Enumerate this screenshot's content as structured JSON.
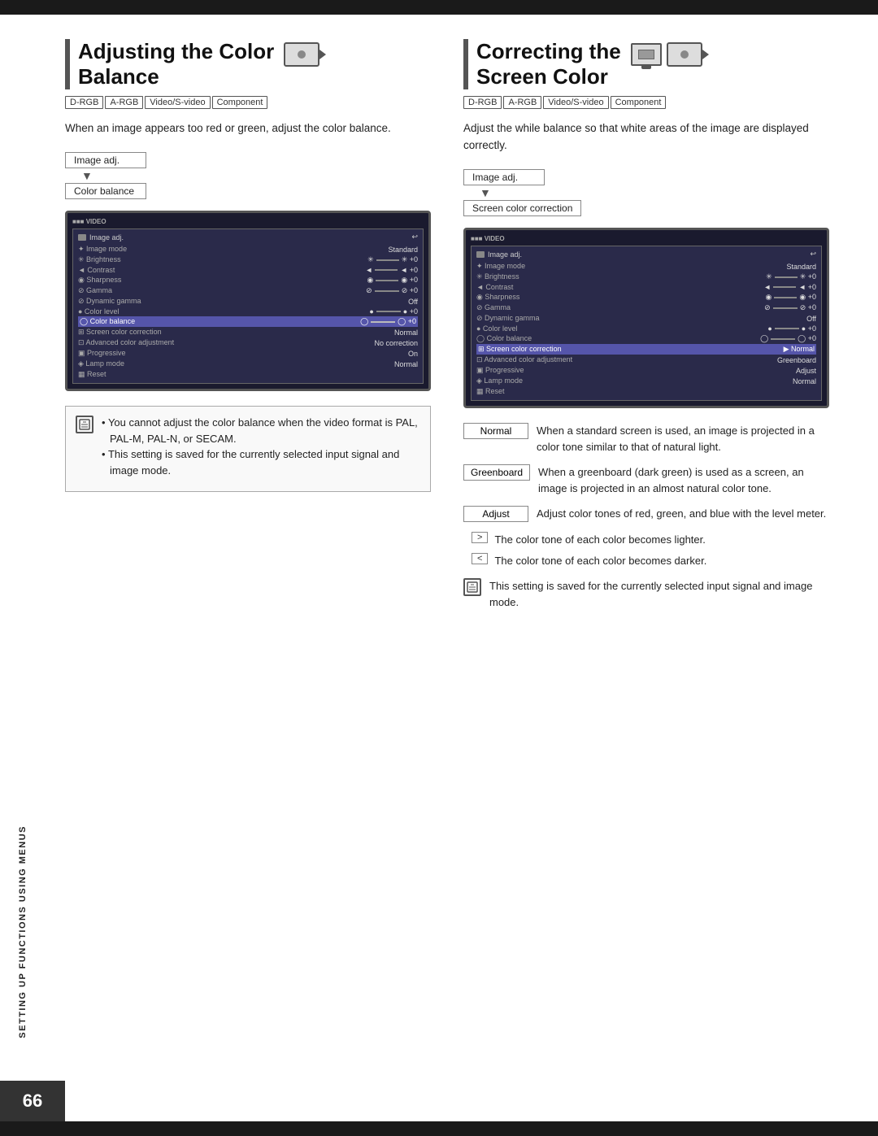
{
  "page": {
    "number": "66",
    "top_bar_color": "#1a1a1a",
    "side_label": "SETTING UP FUNCTIONS USING MENUS"
  },
  "left_section": {
    "title_line1": "Adjusting the Color",
    "title_line2": "Balance",
    "compat_tags": [
      "D-RGB",
      "A-RGB",
      "Video/S-video",
      "Component"
    ],
    "description": "When an image appears too red or green, adjust the color balance.",
    "menu_flow": {
      "item1": "Image adj.",
      "item2": "Color balance"
    },
    "video_screen": {
      "header_label": "VIDEO",
      "title": "Image adj.",
      "rows": [
        {
          "label": "Image mode",
          "value": "Standard",
          "highlighted": false
        },
        {
          "label": "Brightness",
          "value": "✳ ═══ ✳ +0",
          "highlighted": false
        },
        {
          "label": "Contrast",
          "value": "◄ ═══ ◄ +0",
          "highlighted": false
        },
        {
          "label": "Sharpness",
          "value": "◉ ═══ ◉ +0",
          "highlighted": false
        },
        {
          "label": "Gamma",
          "value": "⊘ ════ ⊘ +0",
          "highlighted": false
        },
        {
          "label": "Dynamic gamma",
          "value": "Off",
          "highlighted": false
        },
        {
          "label": "Color level",
          "value": "● ════ ● +0",
          "highlighted": false
        },
        {
          "label": "Color balance",
          "value": "◯ ════ ◯ +0",
          "highlighted": true
        },
        {
          "label": "Screen color correction",
          "value": "Normal",
          "highlighted": false
        },
        {
          "label": "Advanced color adjustment",
          "value": "No correction",
          "highlighted": false
        },
        {
          "label": "Progressive",
          "value": "On",
          "highlighted": false
        },
        {
          "label": "Lamp mode",
          "value": "Normal",
          "highlighted": false
        },
        {
          "label": "Reset",
          "value": "",
          "highlighted": false
        }
      ]
    },
    "notes": {
      "icon": "i",
      "bullets": [
        "You cannot adjust the color balance when the video format is PAL, PAL-M, PAL-N, or SECAM.",
        "This setting is saved for the currently selected input signal and image mode."
      ]
    }
  },
  "right_section": {
    "title_line1": "Correcting the",
    "title_line2": "Screen Color",
    "compat_tags": [
      "D-RGB",
      "A-RGB",
      "Video/S-video",
      "Component"
    ],
    "description": "Adjust the while balance so that white areas of the image are displayed correctly.",
    "menu_flow": {
      "item1": "Image adj.",
      "item2": "Screen color correction"
    },
    "video_screen": {
      "header_label": "VIDEO",
      "title": "Image adj.",
      "rows": [
        {
          "label": "Image mode",
          "value": "Standard",
          "highlighted": false
        },
        {
          "label": "Brightness",
          "value": "✳ ═══ ✳ +0",
          "highlighted": false
        },
        {
          "label": "Contrast",
          "value": "◄ ═══ ◄ +0",
          "highlighted": false
        },
        {
          "label": "Sharpness",
          "value": "◉ ═══ ◉ +0",
          "highlighted": false
        },
        {
          "label": "Gamma",
          "value": "⊘ ════ ⊘ +0",
          "highlighted": false
        },
        {
          "label": "Dynamic gamma",
          "value": "Off",
          "highlighted": false
        },
        {
          "label": "Color level",
          "value": "● ════ ● +0",
          "highlighted": false
        },
        {
          "label": "Color balance",
          "value": "◯ ════ ◯ +0",
          "highlighted": false
        },
        {
          "label": "Screen color correction",
          "value": "▶ Normal",
          "highlighted": true
        },
        {
          "label": "Advanced color adjustment",
          "value": "Greenboard",
          "highlighted": false
        },
        {
          "label": "Progressive",
          "value": "Adjust",
          "highlighted": false
        },
        {
          "label": "Lamp mode",
          "value": "Normal",
          "highlighted": false
        },
        {
          "label": "Reset",
          "value": "",
          "highlighted": false
        }
      ]
    },
    "correction_items": [
      {
        "label": "Normal",
        "description": "When a standard screen is used, an image is projected in a color tone similar to that of natural light."
      },
      {
        "label": "Greenboard",
        "description": "When a greenboard (dark green) is used as a screen, an image is projected in an almost natural color tone."
      },
      {
        "label": "Adjust",
        "description": "Adjust color tones of red, green, and blue with the level meter."
      }
    ],
    "arrow_items": [
      {
        "arrow": ">",
        "description": "The color tone of each color becomes lighter."
      },
      {
        "arrow": "<",
        "description": "The color tone of each color becomes darker."
      }
    ],
    "bottom_note": {
      "icon": "i",
      "text": "This setting is saved for the currently selected input signal and image mode."
    }
  }
}
